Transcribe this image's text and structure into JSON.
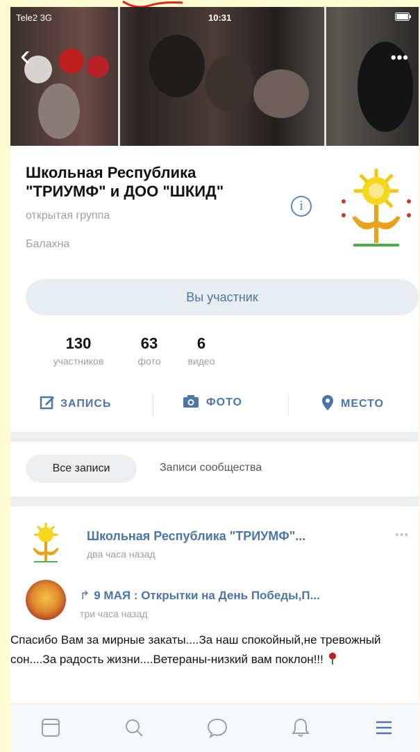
{
  "status_bar": {
    "carrier": "Tele2 3G",
    "time": "10:31"
  },
  "header": {
    "group_title": "Школьная Республика \"ТРИУМФ\" и ДОО \"ШКИД\"",
    "group_type": "открытая группа",
    "city": "Балахна",
    "member_button": "Вы участник"
  },
  "stats": [
    {
      "value": "130",
      "label": "участников"
    },
    {
      "value": "63",
      "label": "фото"
    },
    {
      "value": "6",
      "label": "видео"
    }
  ],
  "actions": [
    {
      "label": "ЗАПИСЬ",
      "icon": "edit-icon"
    },
    {
      "label": "ФОТО",
      "icon": "camera-icon"
    },
    {
      "label": "МЕСТО",
      "icon": "location-pin-icon"
    }
  ],
  "filter_tabs": {
    "all_posts": "Все записи",
    "community_posts": "Записи сообщества"
  },
  "post": {
    "author": "Школьная Республика \"ТРИУМФ\"...",
    "time": "два часа назад",
    "repost_title": "9 МАЯ : Открытки на День Победы,П...",
    "repost_time": "три часа назад",
    "text": "Спасибо Вам за мирные закаты....За наш спокойный,не тревожный сон....За радость жизни....Ветераны-низкий вам поклон!!!"
  },
  "colors": {
    "accent": "#4a76a8",
    "muted": "#9aa0a6",
    "page_background": "#fdfbd0"
  },
  "bottom_nav": [
    "news-icon",
    "search-icon",
    "messages-icon",
    "notifications-icon",
    "menu-icon"
  ]
}
